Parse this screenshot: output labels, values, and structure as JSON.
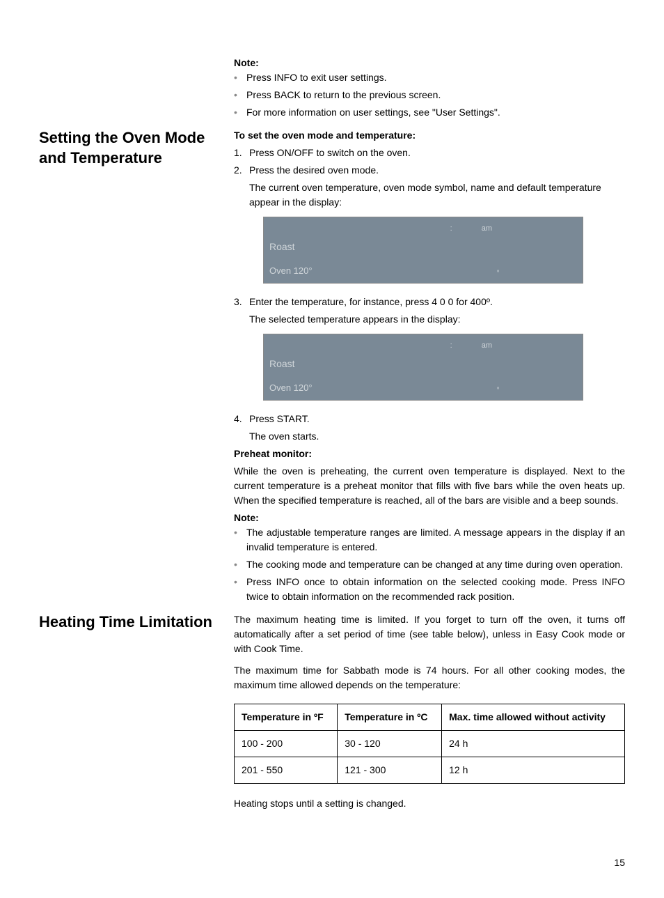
{
  "note1": {
    "heading": "Note:",
    "items": [
      "Press INFO to exit user settings.",
      "Press BACK to return to the previous screen.",
      "For more information on user settings, see \"User Settings\"."
    ]
  },
  "section1": {
    "title": "Setting the Oven Mode and Temperature",
    "intro": "To set the oven mode and temperature:",
    "steps": {
      "s1": "Press ON/OFF to switch on the oven.",
      "s2": "Press the desired oven mode.",
      "s2sub": "The current oven temperature, oven mode symbol, name and default temperature appear in the display:",
      "s3": "Enter the temperature, for instance, press 4 0 0 for 400º.",
      "s3sub": "The selected temperature appears in the display:",
      "s4": "Press START.",
      "s4sub": "The oven starts."
    },
    "display1": {
      "ampm": "am",
      "mode": "Roast",
      "bottom": "Oven 120°",
      "deg": "º"
    },
    "display2": {
      "ampm": "am",
      "mode": "Roast",
      "bottom": "Oven 120°",
      "deg": "º"
    },
    "preheat_heading": "Preheat monitor:",
    "preheat_text": "While the oven is preheating, the current oven temperature is displayed. Next to the current temperature is a preheat monitor that fills with five bars while the oven heats up. When the specified temperature is reached, all of the bars are visible and a beep sounds.",
    "note_heading": "Note:",
    "note_items": [
      "The adjustable temperature ranges are limited. A message appears in the display if an invalid temperature is entered.",
      "The cooking mode and temperature can be changed at any time during oven operation.",
      "Press INFO once to obtain information on the selected cooking mode. Press INFO twice to obtain information on the recommended rack position."
    ]
  },
  "section2": {
    "title": "Heating Time Limitation",
    "p1": "The maximum heating time is limited. If you forget to turn off the oven, it turns off automatically after a set period of time (see table below), unless in Easy Cook mode or with Cook Time.",
    "p2": "The maximum time for Sabbath mode is 74 hours. For all other cooking modes, the maximum time allowed depends on the temperature:",
    "table": {
      "headers": [
        "Temperature in ºF",
        "Temperature in ºC",
        "Max. time allowed without activity"
      ],
      "rows": [
        [
          "100 - 200",
          "30 - 120",
          "24 h"
        ],
        [
          "201 - 550",
          "121 - 300",
          "12 h"
        ]
      ]
    },
    "p3": "Heating stops until a setting is changed."
  },
  "page": "15"
}
